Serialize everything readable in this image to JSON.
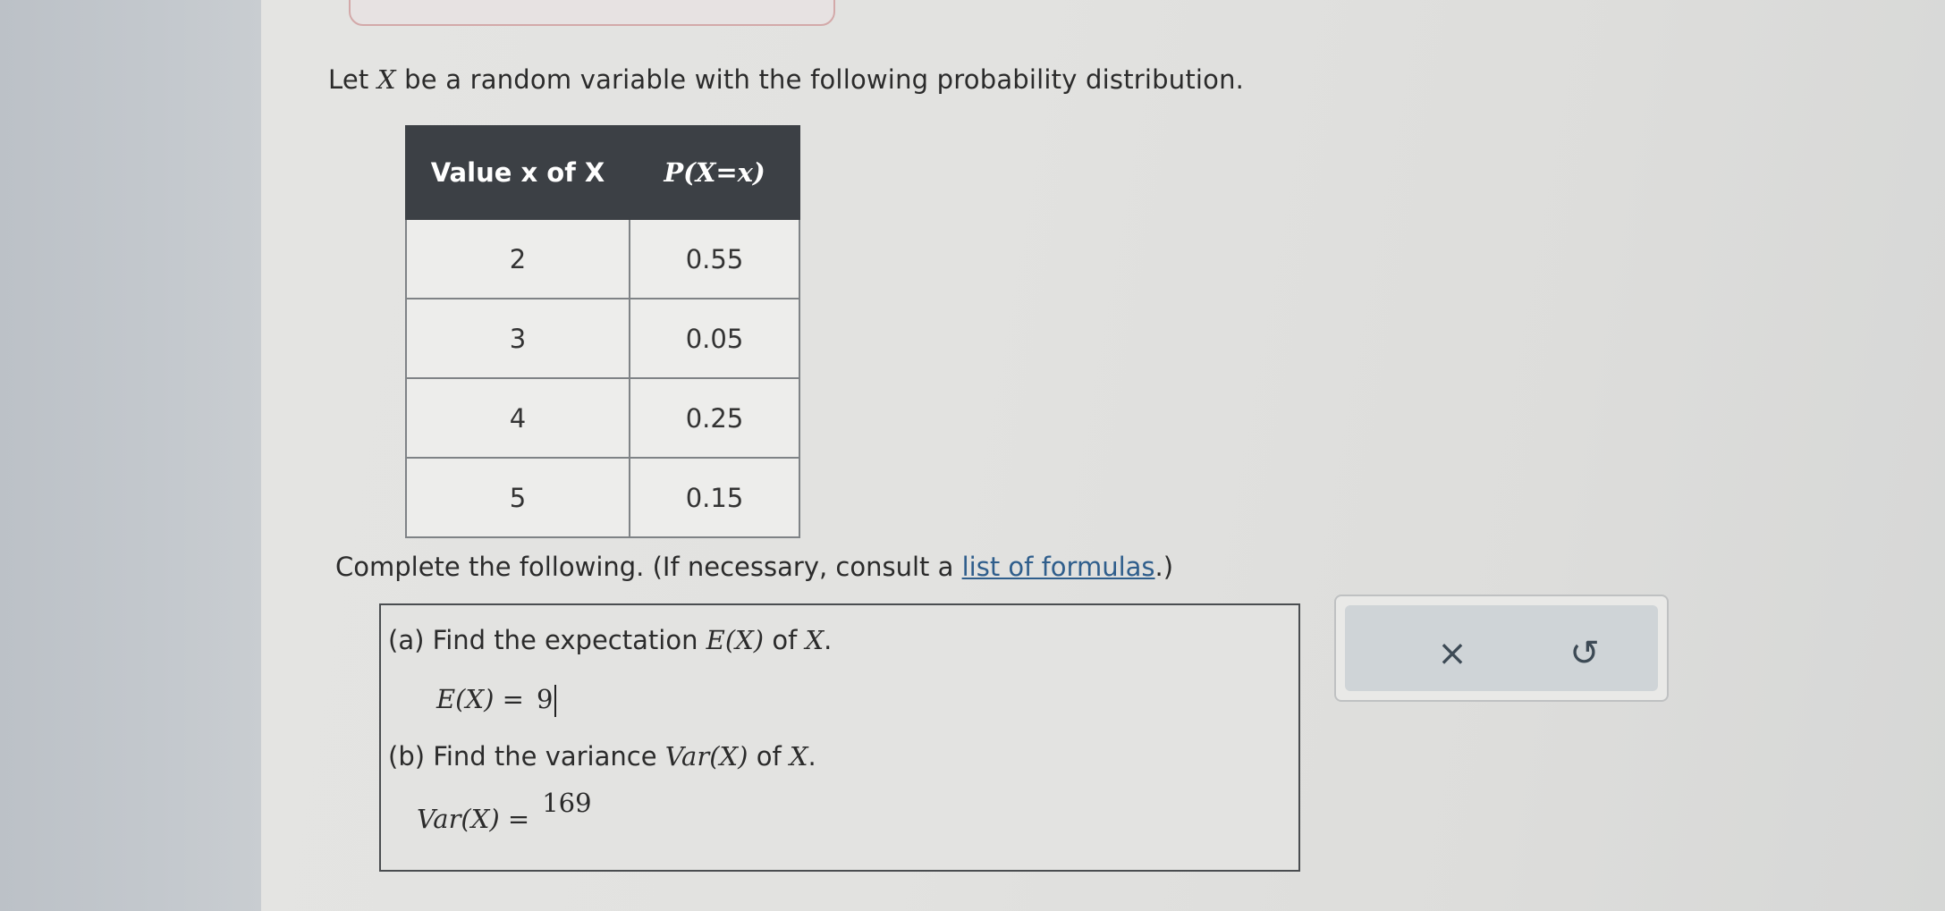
{
  "intro": {
    "prefix": "Let ",
    "variable": "X",
    "suffix": " be a random variable with the following probability distribution."
  },
  "table": {
    "headers": [
      "Value x of X",
      "P(X=x)"
    ],
    "rows": [
      [
        "2",
        "0.55"
      ],
      [
        "3",
        "0.05"
      ],
      [
        "4",
        "0.25"
      ],
      [
        "5",
        "0.15"
      ]
    ]
  },
  "instructions": {
    "prefix": "Complete the following. (If necessary, consult a ",
    "link_text": "list of formulas",
    "suffix": ".)"
  },
  "questions": {
    "a_label": "(a) Find the expectation ",
    "a_expr": "E(X)",
    "a_tail": " of ",
    "a_var": "X",
    "a_end": ".",
    "a_answer_label": "E(X) =",
    "a_answer_value": "9",
    "b_label": "(b) Find the variance ",
    "b_expr": "Var(X)",
    "b_tail": " of ",
    "b_var": "X",
    "b_end": ".",
    "b_answer_label": "Var(X) =",
    "b_answer_value": "169"
  },
  "tools": {
    "clear_icon": "×",
    "undo_icon": "↺"
  },
  "colors": {
    "header_bg": "#3c4045",
    "link": "#2f5e8c"
  }
}
